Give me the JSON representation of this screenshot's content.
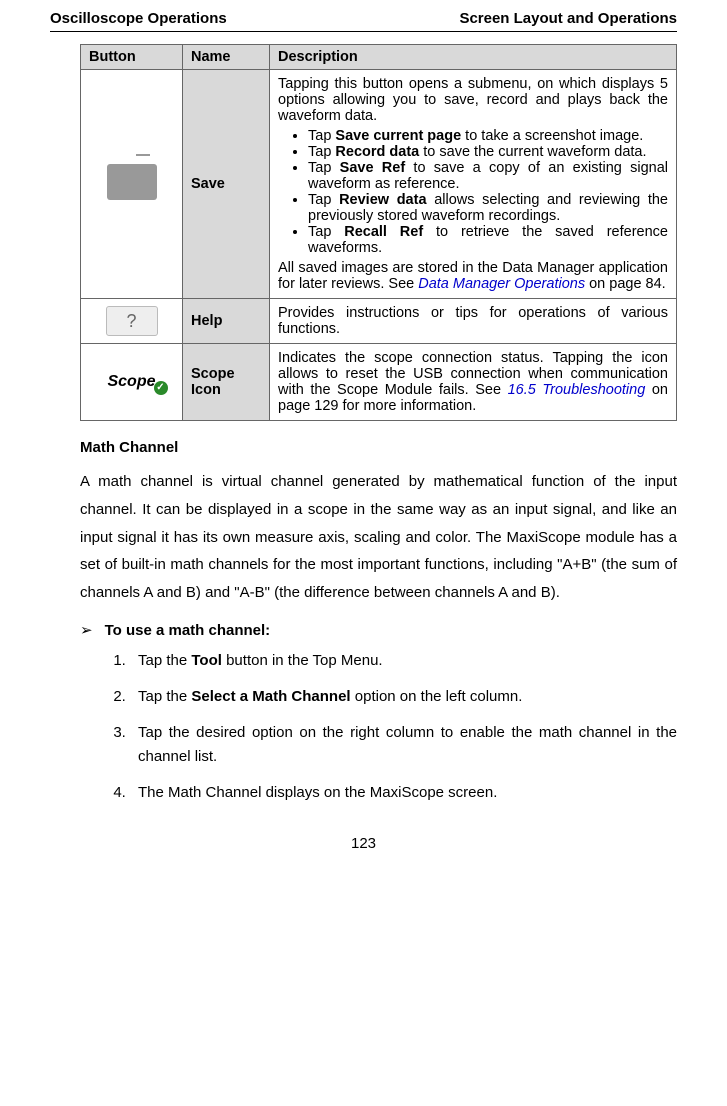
{
  "header": {
    "left": "Oscilloscope Operations",
    "right": "Screen Layout and Operations"
  },
  "table": {
    "headers": {
      "button": "Button",
      "name": "Name",
      "desc": "Description"
    },
    "rows": {
      "save": {
        "name": "Save",
        "intro": "Tapping this button opens a submenu, on which displays 5 options allowing you to save, record and plays back the waveform data.",
        "b1_pre": "Tap ",
        "b1_bold": "Save current page",
        "b1_post": " to take a screenshot image.",
        "b2_pre": "Tap ",
        "b2_bold": "Record data",
        "b2_post": " to save the current waveform data.",
        "b3_pre": "Tap ",
        "b3_bold": "Save Ref",
        "b3_post": " to save a copy of an existing signal waveform as reference.",
        "b4_pre": "Tap ",
        "b4_bold": "Review data",
        "b4_post": " allows selecting and reviewing the previously stored waveform recordings.",
        "b5_pre": "Tap ",
        "b5_bold": "Recall Ref",
        "b5_post": " to retrieve the saved reference waveforms.",
        "outro_pre": "All saved images are stored in the Data Manager application for later reviews. See ",
        "outro_link": "Data Manager Operations",
        "outro_post": " on page 84."
      },
      "help": {
        "name": "Help",
        "desc": "Provides instructions or tips for operations of various functions.",
        "icon_glyph": "?"
      },
      "scope": {
        "name": "Scope Icon",
        "desc_pre": "Indicates the scope connection status. Tapping the icon allows to reset the USB connection when communication with the Scope Module fails. See ",
        "desc_link": "16.5 Troubleshooting",
        "desc_post": " on page 129 for more information.",
        "icon_text": "Scope",
        "check": "✓"
      }
    }
  },
  "section": {
    "head": "Math Channel",
    "para": "A math channel is virtual channel generated by mathematical function of the input channel. It can be displayed in a scope in the same way as an input signal, and like an input signal it has its own measure axis, scaling and color. The MaxiScope module has a set of built-in math channels for the most important functions, including \"A+B\" (the sum of channels A and B) and \"A-B\" (the difference between channels A and B)."
  },
  "howto": {
    "arrow": "➢",
    "title_pre": "To use a math channel",
    "colon": ":",
    "s1_pre": "Tap the ",
    "s1_bold": "Tool",
    "s1_post": " button in the Top Menu.",
    "s2_pre": "Tap the ",
    "s2_bold": "Select a Math Channel",
    "s2_post": " option on the left column.",
    "s3": "Tap the desired option on the right column to enable the math channel in the channel list.",
    "s4": "The Math Channel displays on the MaxiScope screen."
  },
  "pageNum": "123"
}
